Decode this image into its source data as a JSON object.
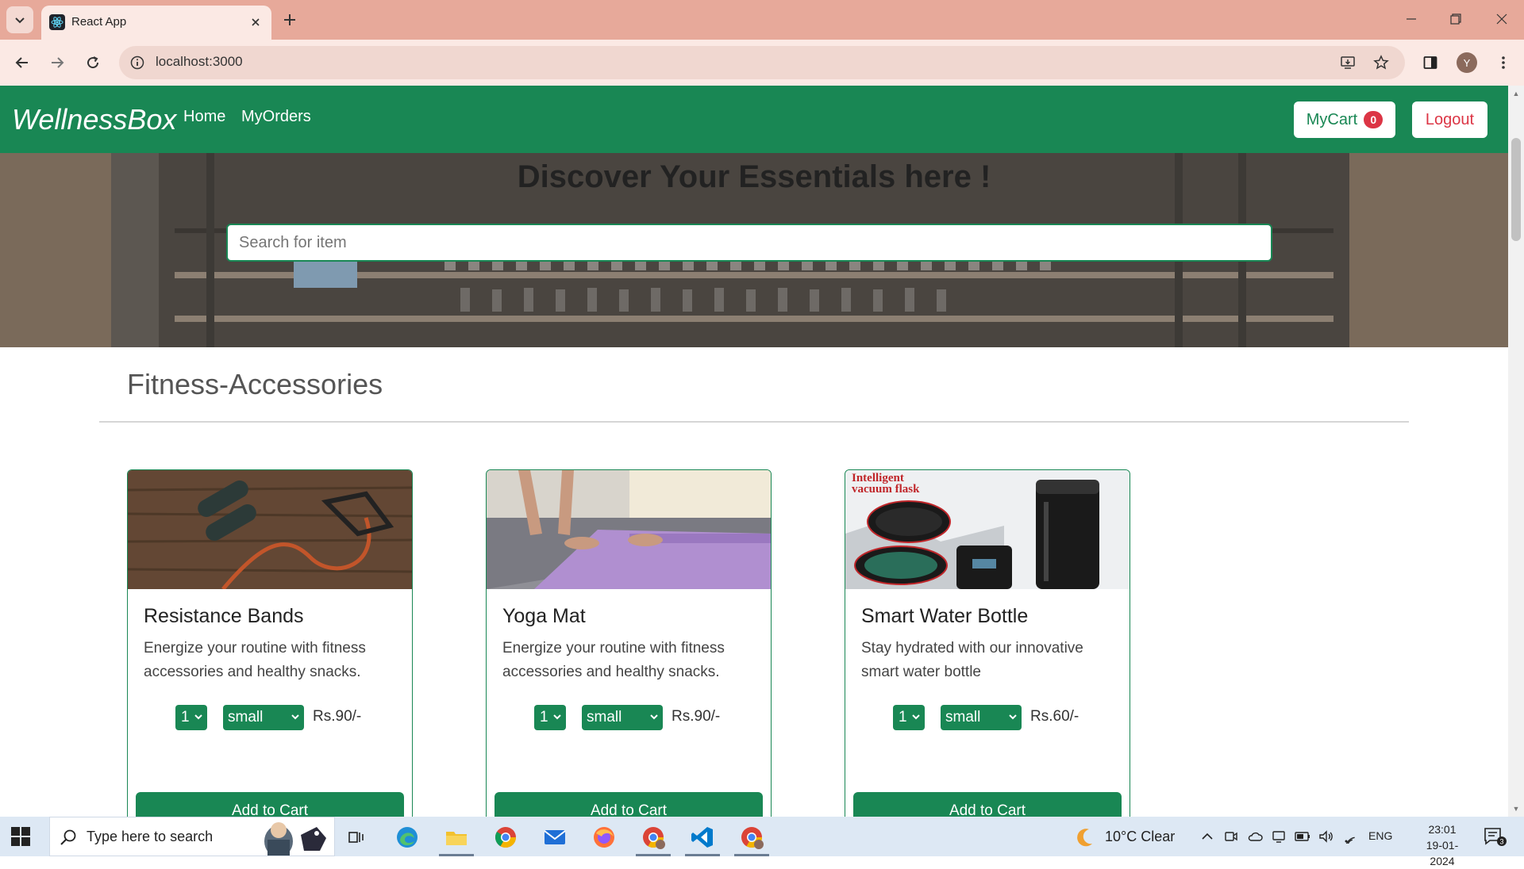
{
  "browser": {
    "tab_title": "React App",
    "url": "localhost:3000",
    "profile_initial": "Y"
  },
  "navbar": {
    "brand": "WellnessBox",
    "links": [
      "Home",
      "MyOrders"
    ],
    "cart_label": "MyCart",
    "cart_count": "0",
    "logout_label": "Logout"
  },
  "hero": {
    "title": "Discover Your Essentials here !",
    "search_placeholder": "Search for item"
  },
  "section": {
    "title": "Fitness-Accessories"
  },
  "products": [
    {
      "name": "Resistance Bands",
      "description": "Energize your routine with fitness accessories and healthy snacks.",
      "qty": "1",
      "size": "small",
      "price": "Rs.90/-",
      "button": "Add to Cart"
    },
    {
      "name": "Yoga Mat",
      "description": "Energize your routine with fitness accessories and healthy snacks.",
      "qty": "1",
      "size": "small",
      "price": "Rs.90/-",
      "button": "Add to Cart"
    },
    {
      "name": "Smart Water Bottle",
      "description": "Stay hydrated with our innovative smart water bottle",
      "qty": "1",
      "size": "small",
      "price": "Rs.60/-",
      "button": "Add to Cart",
      "image_text": "Intelligent vacuum flask"
    }
  ],
  "taskbar": {
    "search_placeholder": "Type here to search",
    "weather": "10°C  Clear",
    "language": "ENG",
    "time": "23:01",
    "date": "19-01-2024",
    "notification_count": "3"
  },
  "colors": {
    "brand_green": "#198754",
    "danger_red": "#dc3545",
    "chrome_tab": "#e7a99a"
  }
}
